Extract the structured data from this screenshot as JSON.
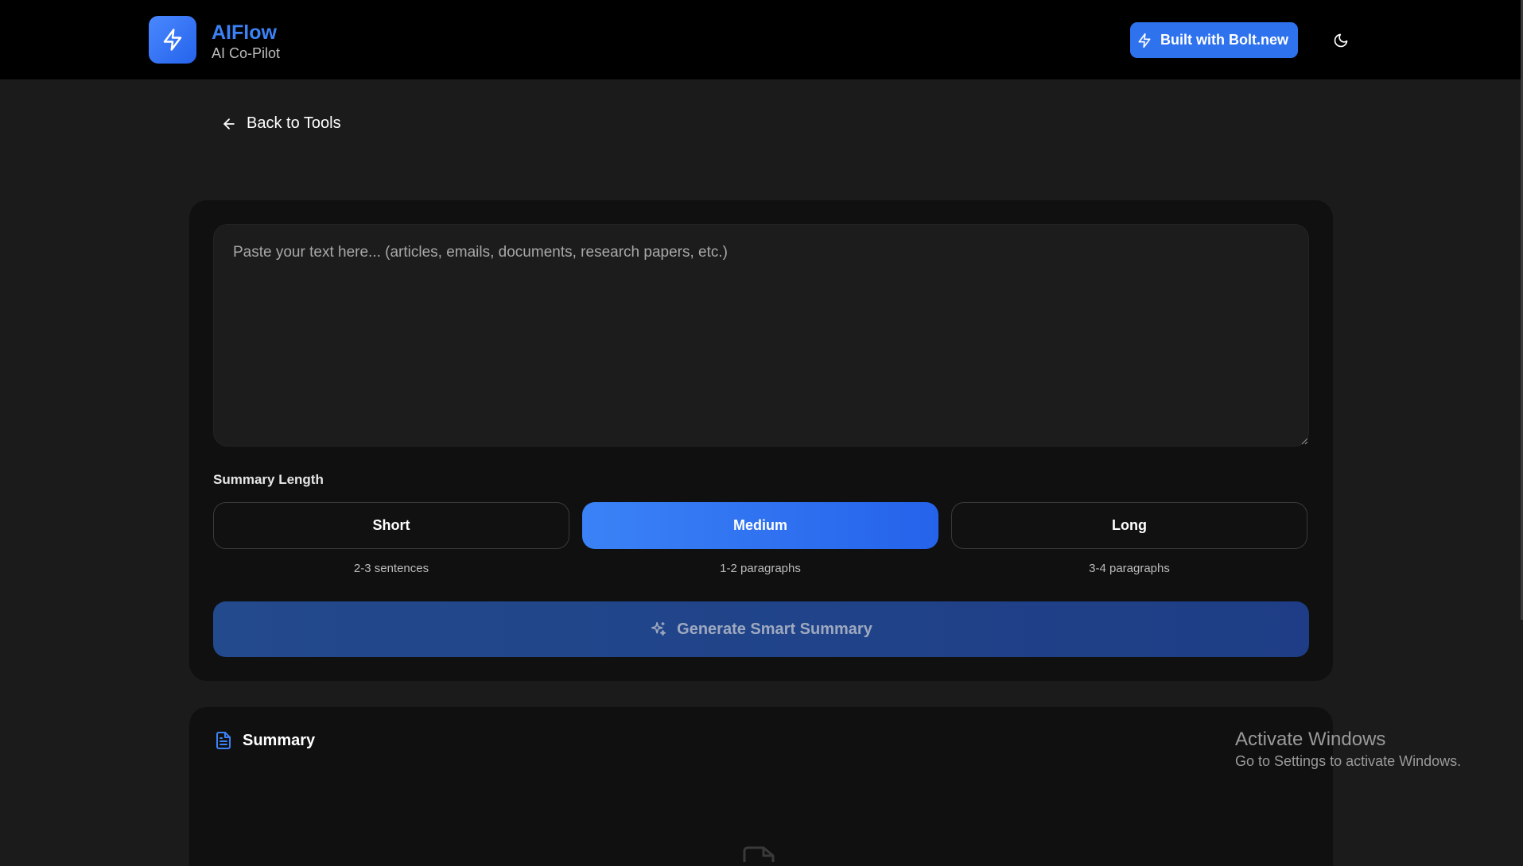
{
  "header": {
    "brand_title": "AIFlow",
    "brand_subtitle": "AI Co-Pilot",
    "bolt_button_label": "Built with Bolt.new",
    "accent_color": "#3b82f6"
  },
  "nav": {
    "back_label": "Back to Tools"
  },
  "input": {
    "placeholder": "Paste your text here... (articles, emails, documents, research papers, etc.)",
    "value": ""
  },
  "summary_length": {
    "label": "Summary Length",
    "options": [
      {
        "label": "Short",
        "desc": "2-3 sentences",
        "selected": false
      },
      {
        "label": "Medium",
        "desc": "1-2 paragraphs",
        "selected": true
      },
      {
        "label": "Long",
        "desc": "3-4 paragraphs",
        "selected": false
      }
    ]
  },
  "actions": {
    "generate_label": "Generate Smart Summary"
  },
  "summary": {
    "title": "Summary"
  },
  "system": {
    "activate_title": "Activate Windows",
    "activate_sub": "Go to Settings to activate Windows."
  },
  "icons": {
    "logo": "bolt-icon",
    "theme": "moon-icon",
    "back": "arrow-left-icon",
    "generate": "sparkles-icon",
    "summary": "document-icon"
  }
}
